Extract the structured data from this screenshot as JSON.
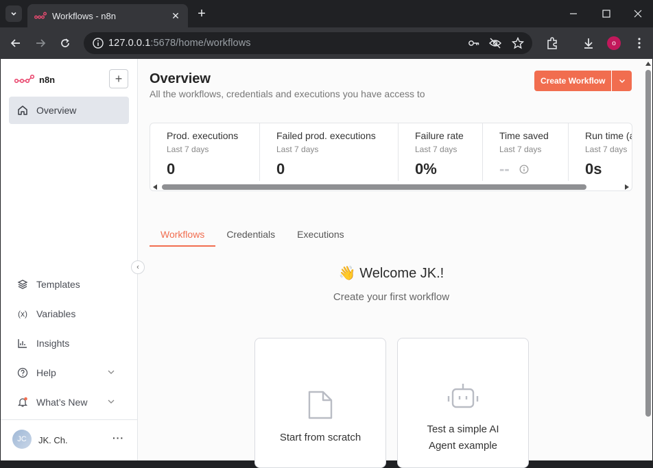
{
  "browser": {
    "tab_title": "Workflows - n8n",
    "url_host": "127.0.0.1",
    "url_path": ":5678/home/workflows",
    "profile_initial": "o"
  },
  "sidebar": {
    "logo_text": "n8n",
    "overview_label": "Overview",
    "items": [
      {
        "label": "Templates",
        "icon": "templates-icon"
      },
      {
        "label": "Variables",
        "icon": "variables-icon"
      },
      {
        "label": "Insights",
        "icon": "insights-icon"
      },
      {
        "label": "Help",
        "icon": "help-icon"
      },
      {
        "label": "What’s New",
        "icon": "bell-icon"
      }
    ],
    "user_initials": "JC",
    "user_name": "JK. Ch.",
    "user_menu": "···"
  },
  "main": {
    "title": "Overview",
    "subtitle": "All the workflows, credentials and executions you have access to",
    "create_button": "Create Workflow",
    "stats": [
      {
        "title": "Prod. executions",
        "period": "Last 7 days",
        "value": "0"
      },
      {
        "title": "Failed prod. executions",
        "period": "Last 7 days",
        "value": "0"
      },
      {
        "title": "Failure rate",
        "period": "Last 7 days",
        "value": "0%"
      },
      {
        "title": "Time saved",
        "period": "Last 7 days",
        "value": "--"
      },
      {
        "title": "Run time (a",
        "period": "Last 7 days",
        "value": "0s"
      }
    ],
    "tabs": [
      "Workflows",
      "Credentials",
      "Executions"
    ],
    "welcome_title": "👋 Welcome JK.!",
    "welcome_sub": "Create your first workflow",
    "cards": [
      {
        "line1": "Start from scratch",
        "line2": ""
      },
      {
        "line1": "Test a simple AI",
        "line2": "Agent example"
      }
    ]
  },
  "colors": {
    "accent": "#f16d4f",
    "brand": "#ea4b71"
  }
}
